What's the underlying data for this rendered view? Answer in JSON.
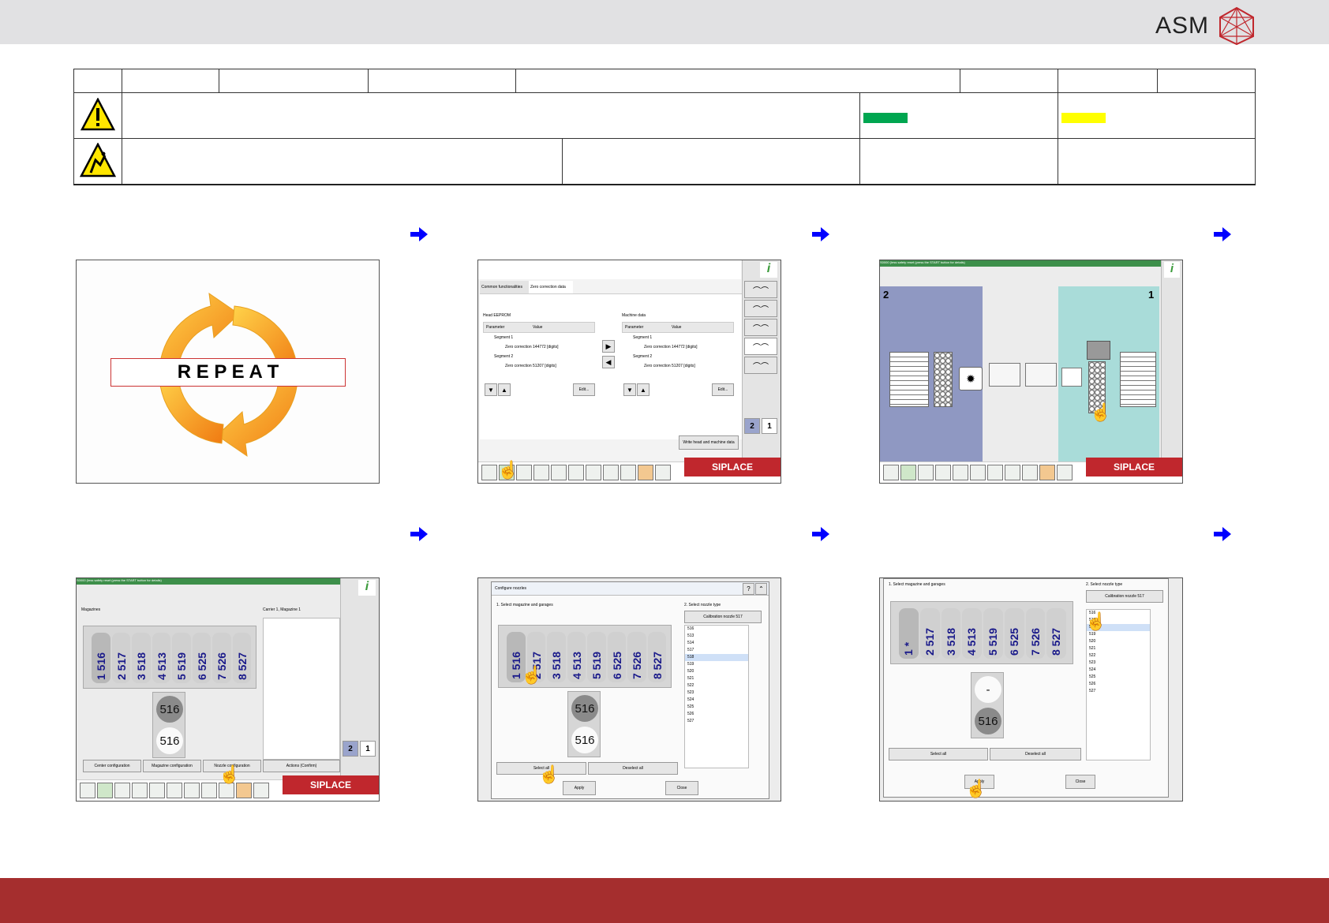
{
  "brand": {
    "logo_text": "ASM"
  },
  "colors": {
    "topbar": "#e1e1e3",
    "bottombar": "#a52e2e",
    "status_green": "#00a650",
    "status_yellow": "#ffff00",
    "arrow_blue": "#0000ff",
    "siplace_red": "#c0272d"
  },
  "header_table": {
    "warning_icon": "warning-triangle-icon",
    "esd_icon": "esd-icon"
  },
  "steps": [
    {
      "name": "repeat",
      "repeat_text": "R E P E A T"
    },
    {
      "name": "zero-correction",
      "tab1": "Common functionalities",
      "tab2": "Zero correction data",
      "left_title": "Head EEPROM",
      "right_title": "Machine data",
      "col_param": "Parameter",
      "col_value": "Value",
      "seg1": "Segment 1",
      "seg2": "Segment 2",
      "zc1_left": "Zero correction 144772 [digits]",
      "zc2_left": "Zero correction 51207 [digits]",
      "zc1_right": "Zero correction 144772 [digits]",
      "zc2_right": "Zero correction 51207 [digits]",
      "edit": "Edit...",
      "write_btn": "Write head and machine data",
      "brand": "SIPLACE"
    },
    {
      "name": "station-view",
      "title": "S0000 (Iess safety reset (press the START button for details)",
      "left_num": "2",
      "right_num": "1",
      "brand": "SIPLACE"
    },
    {
      "name": "magazine-view",
      "title": "S0000 (Iess safety reset (press the START button for details)",
      "mag_title": "Magazines",
      "carrier_title": "Carrier 1, Magazine 1",
      "nozzles": [
        "516",
        "517",
        "518",
        "513",
        "519",
        "525",
        "526",
        "527"
      ],
      "positions": [
        "1",
        "2",
        "3",
        "4",
        "5",
        "6",
        "7",
        "8"
      ],
      "garage_top": "516",
      "garage_bottom": "516",
      "btn_center": "Center configuration",
      "btn_magazine": "Magazine configuration",
      "btn_nozzle": "Nozzle configuration",
      "actions": "Actions (Confirm)",
      "brand": "SIPLACE"
    },
    {
      "name": "configure-nozzles",
      "dialog_title": "Configure nozzles",
      "select_mag": "1. Select magazine and garages",
      "select_type": "2. Select nozzle type",
      "calibration": "Calibration nozzle 517",
      "nozzles": [
        "516",
        "517",
        "518",
        "513",
        "519",
        "525",
        "526",
        "527"
      ],
      "positions": [
        "1",
        "2",
        "3",
        "4",
        "5",
        "6",
        "7",
        "8"
      ],
      "garage_top": "516",
      "garage_bottom": "516",
      "list": [
        "516",
        "513",
        "514",
        "517",
        "518",
        "519",
        "520",
        "521",
        "522",
        "523",
        "524",
        "525",
        "526",
        "527"
      ],
      "select_all": "Select all",
      "deselect_all": "Deselect all",
      "apply": "Apply",
      "close": "Close"
    },
    {
      "name": "apply-nozzles",
      "select_mag": "1. Select magazine and garages",
      "select_type": "2. Select nozzle type",
      "calibration": "Calibration nozzle 517",
      "nozzles": [
        "*",
        "517",
        "518",
        "513",
        "519",
        "525",
        "526",
        "527"
      ],
      "positions": [
        "1",
        "2",
        "3",
        "4",
        "5",
        "6",
        "7",
        "8"
      ],
      "garage_top": "-",
      "garage_bottom": "516",
      "list": [
        "516",
        "517",
        "518",
        "519",
        "520",
        "521",
        "522",
        "523",
        "524",
        "525",
        "526",
        "527"
      ],
      "select_all": "Select all",
      "deselect_all": "Deselect all",
      "apply": "Apply",
      "close": "Close"
    }
  ]
}
